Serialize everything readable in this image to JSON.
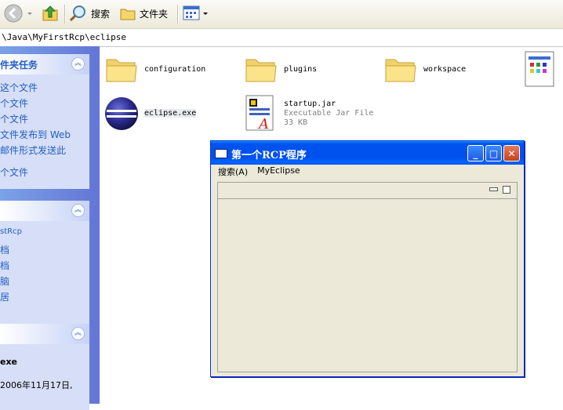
{
  "toolbar": {
    "search_label": "搜索",
    "folders_label": "文件夹"
  },
  "address": {
    "path": "\\Java\\MyFirstRcp\\eclipse"
  },
  "left_pane": {
    "tasks_title": "件夹任务",
    "tasks": [
      "这个文件",
      "个文件",
      "个文件",
      "文件发布到 Web",
      "邮件形式发送此",
      "个文件"
    ],
    "places": [
      "stRcp",
      "档",
      "档",
      "脑",
      "居"
    ],
    "details_name": "exe",
    "details_date": "2006年11月17日,"
  },
  "files": [
    {
      "name": "configuration",
      "type": "folder"
    },
    {
      "name": "plugins",
      "type": "folder"
    },
    {
      "name": "workspace",
      "type": "folder"
    },
    {
      "name": "eclipse.exe",
      "type": "exe"
    },
    {
      "name": "startup.jar",
      "sub1": "Executable Jar File",
      "sub2": "33 KB",
      "type": "jar"
    }
  ],
  "rcp_window": {
    "title": "第一个RCP程序",
    "menu": [
      "搜索(A)",
      "MyEclipse"
    ],
    "buttons": {
      "minimize": "_",
      "maximize": "□",
      "close": "✕"
    }
  },
  "colors": {
    "xp_blue": "#0053ee",
    "left_pane": "#6b8fe0",
    "link": "#215dc6"
  }
}
